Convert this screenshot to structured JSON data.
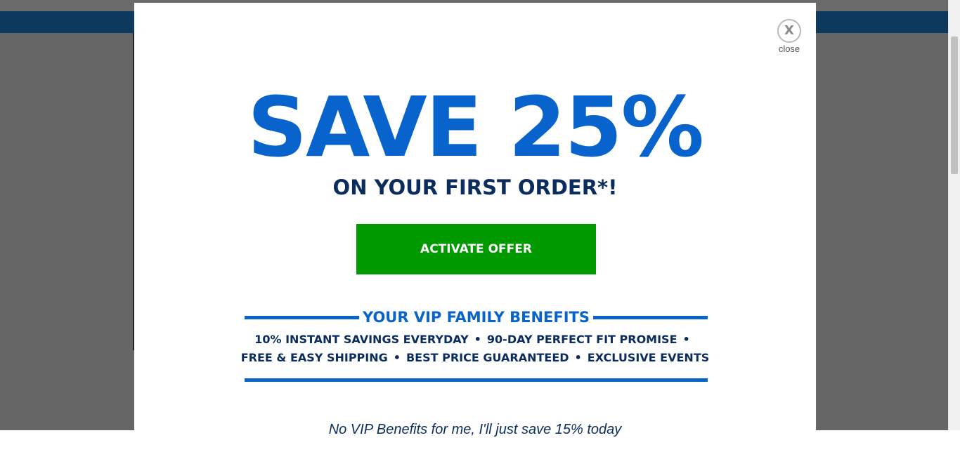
{
  "colors": {
    "overlay": "#666666",
    "top_bar": "#0d3a5c",
    "headline_blue": "#0864cc",
    "navy_text": "#0b2d5e",
    "button_green": "#009a00"
  },
  "modal": {
    "close": {
      "icon": "close-icon",
      "glyph": "X",
      "label": "close"
    },
    "headline": "SAVE 25%",
    "subheadline": "ON YOUR FIRST ORDER*!",
    "cta_label": "ACTIVATE OFFER",
    "benefits": {
      "title": "YOUR VIP FAMILY BENEFITS",
      "row1": [
        "10% INSTANT SAVINGS EVERYDAY",
        "90-DAY PERFECT FIT PROMISE"
      ],
      "row2": [
        "FREE & EASY SHIPPING",
        "BEST PRICE GUARANTEED",
        "EXCLUSIVE EVENTS"
      ],
      "separator": "•"
    },
    "decline_text": "No VIP Benefits for me, I'll just save 15% today"
  }
}
